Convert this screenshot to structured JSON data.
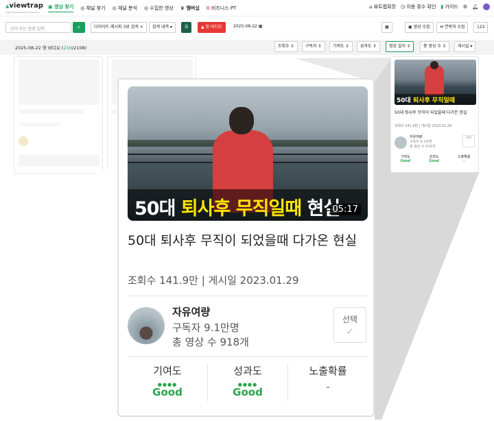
{
  "brand": {
    "name": "viewtrap",
    "tagline": "Video Trend Research Application"
  },
  "nav": {
    "items": [
      {
        "label": "영상 찾기",
        "active": true
      },
      {
        "label": "채널 찾기"
      },
      {
        "label": "채널 분석"
      },
      {
        "label": "수집한 영상"
      },
      {
        "label": "멤버십"
      },
      {
        "label": "비즈니스 PT"
      }
    ]
  },
  "top_right": {
    "extension": "뷰트랩확장",
    "usage": "이용 횟수 확인",
    "guide": "가이드"
  },
  "toolbar": {
    "search_placeholder": "단어 또는 문장 입력",
    "keyword_chip": "다이어트 레시피 3위 검색",
    "search_history": "검색 내역",
    "hot_video": "핫 비디오",
    "date": "2025-08-22",
    "collect_video": "영상 수집",
    "contact_collect": "연락처 수집",
    "number": "123"
  },
  "filterbar": {
    "label_prefix": "2025-08-22 핫 비디오 (",
    "shown": "216",
    "total_suffix": "/2108)",
    "sorts": [
      "조회수",
      "구독자",
      "기여도",
      "성과도",
      "영상 길이",
      "총 영상 수",
      "게시일"
    ]
  },
  "card": {
    "thumbnail_text_white1": "50대 ",
    "thumbnail_text_yellow": "퇴사후 무직일때",
    "thumbnail_text_white2": " 현실",
    "duration": "05:17",
    "title": "50대 퇴사후 무직이 되었을때 다가온 현실",
    "views": "조회수 141.9만",
    "posted": "게시일 2023.01.29",
    "separator": " | ",
    "channel_name": "자유여량",
    "subscribers": "구독자 9.1만명",
    "total_videos": "총 영상 수 918개",
    "select_label": "선택",
    "metrics": [
      {
        "label": "기여도",
        "value": "Good"
      },
      {
        "label": "성과도",
        "value": "Good"
      },
      {
        "label": "노출확률",
        "value": "-"
      }
    ]
  },
  "colors": {
    "accent": "#1a9e5c",
    "good": "#2aa34a",
    "hot": "#e53935"
  }
}
